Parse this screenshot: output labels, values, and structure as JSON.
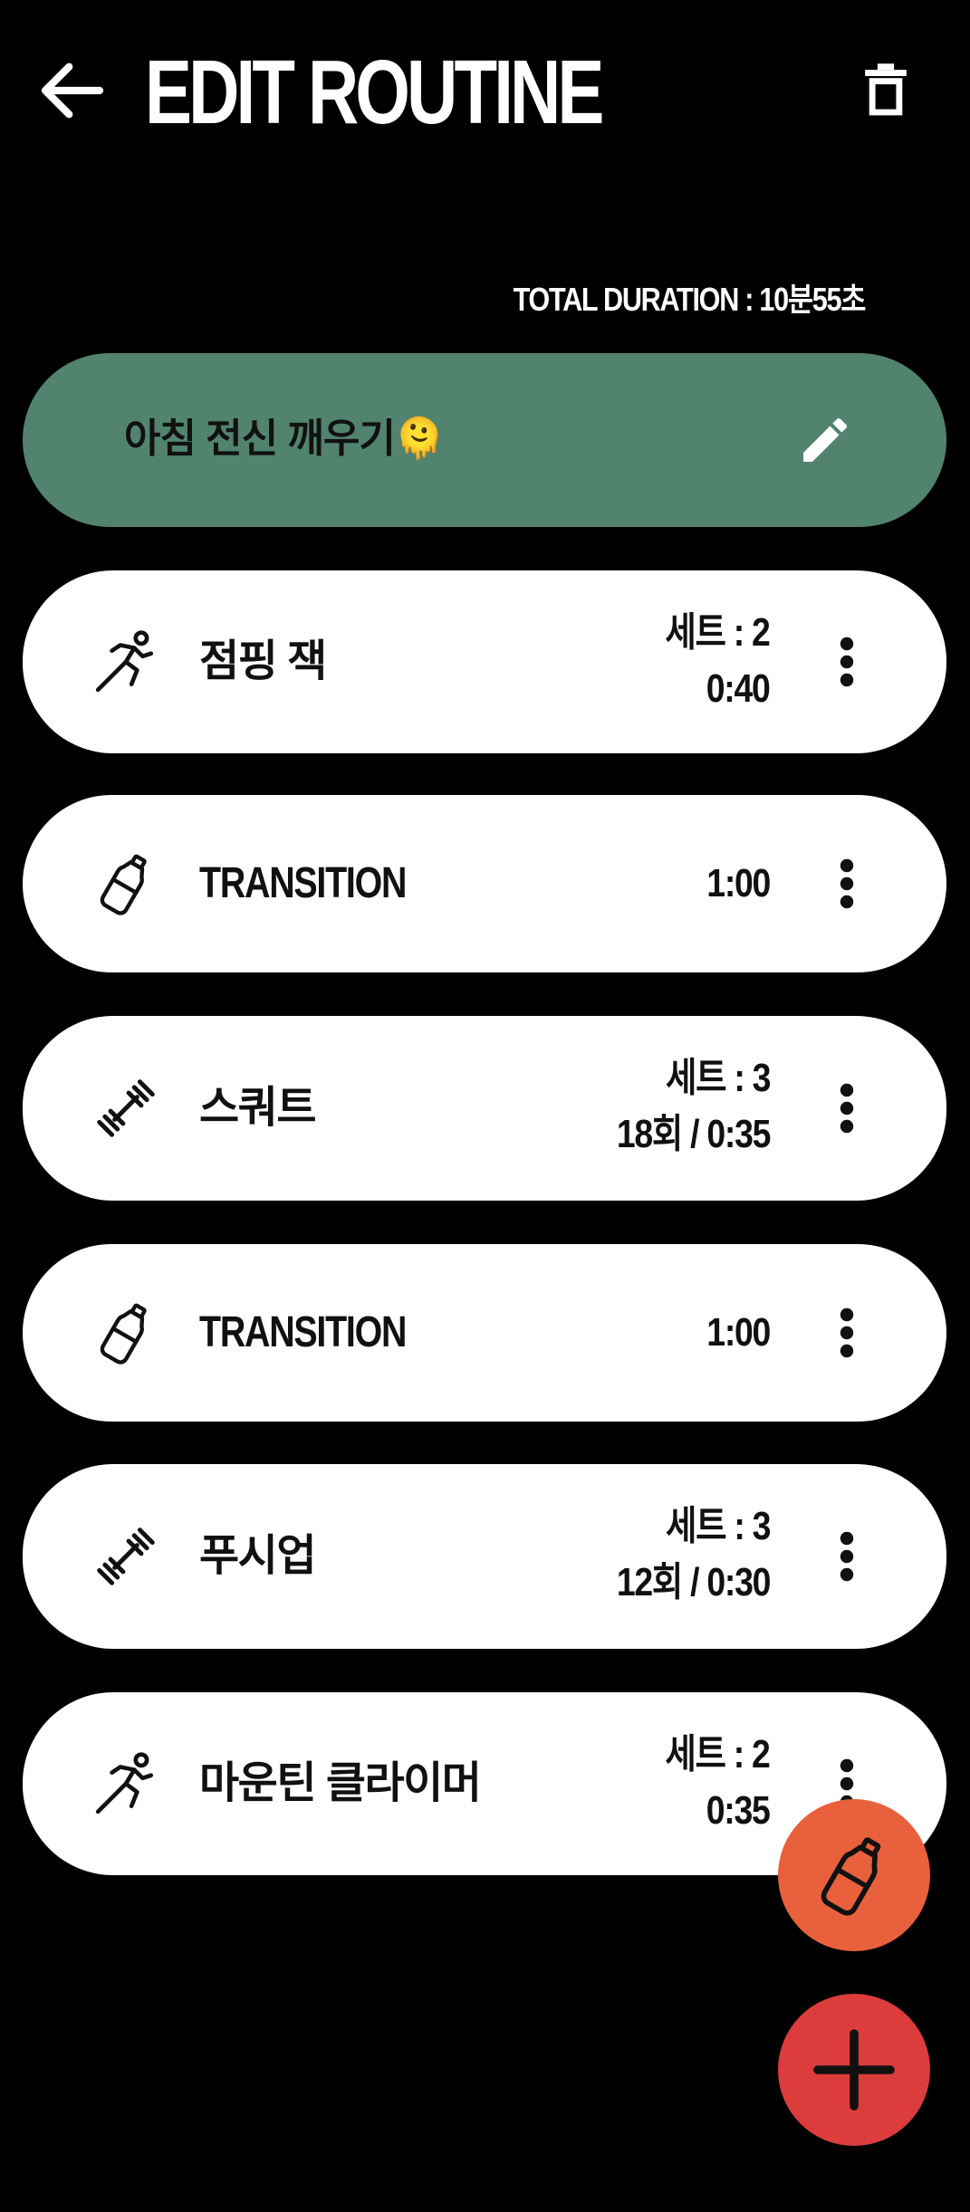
{
  "header": {
    "title": "EDIT ROUTINE",
    "back_icon": "arrow-left-icon",
    "delete_icon": "trash-icon"
  },
  "total_duration": "TOTAL DURATION : 10분55초",
  "routine": {
    "name": "아침 전신 깨우기🫠",
    "card_color": "#52836F",
    "edit_icon": "pencil-icon"
  },
  "items": [
    {
      "icon": "running-person-icon",
      "name": "점핑 잭",
      "sets": "세트 : 2",
      "detail": "0:40"
    },
    {
      "icon": "water-bottle-icon",
      "name": "TRANSITION",
      "sets": "",
      "detail": "1:00"
    },
    {
      "icon": "dumbbell-icon",
      "name": "스쿼트",
      "sets": "세트 : 3",
      "detail": "18회 / 0:35"
    },
    {
      "icon": "water-bottle-icon",
      "name": "TRANSITION",
      "sets": "",
      "detail": "1:00"
    },
    {
      "icon": "dumbbell-icon",
      "name": "푸시업",
      "sets": "세트 : 3",
      "detail": "12회 / 0:30"
    },
    {
      "icon": "running-person-icon",
      "name": "마운틴 클라이머",
      "sets": "세트 : 2",
      "detail": "0:35"
    }
  ],
  "fabs": {
    "transition_color": "#E8603C",
    "add_color": "#DC3C3C"
  }
}
